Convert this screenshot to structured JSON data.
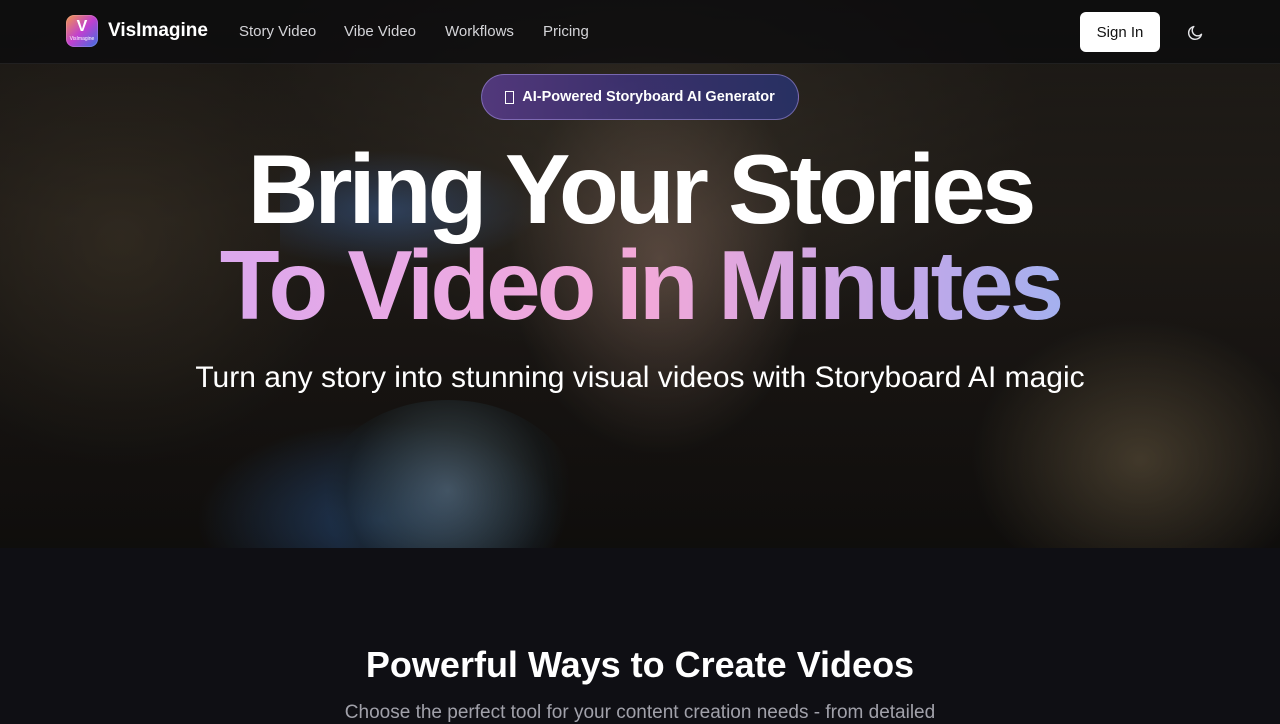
{
  "nav": {
    "brand": "VisImagine",
    "logo_letter": "V",
    "logo_text": "VisImagine",
    "links": [
      "Story Video",
      "Vibe Video",
      "Workflows",
      "Pricing"
    ],
    "sign_in": "Sign In",
    "theme_icon": "moon-icon"
  },
  "hero": {
    "badge": "AI-Powered Storyboard AI Generator",
    "headline_line1": "Bring Your Stories",
    "headline_line2": "To Video in Minutes",
    "subtitle": "Turn any story into stunning visual videos with Storyboard AI magic"
  },
  "section": {
    "title": "Powerful Ways to Create Videos",
    "subtitle": "Choose the perfect tool for your content creation needs - from detailed"
  },
  "colors": {
    "accent_start": "#c9a7f7",
    "accent_mid": "#f2a8d8",
    "accent_end": "#8cc8f8",
    "background": "#0f0f14"
  }
}
